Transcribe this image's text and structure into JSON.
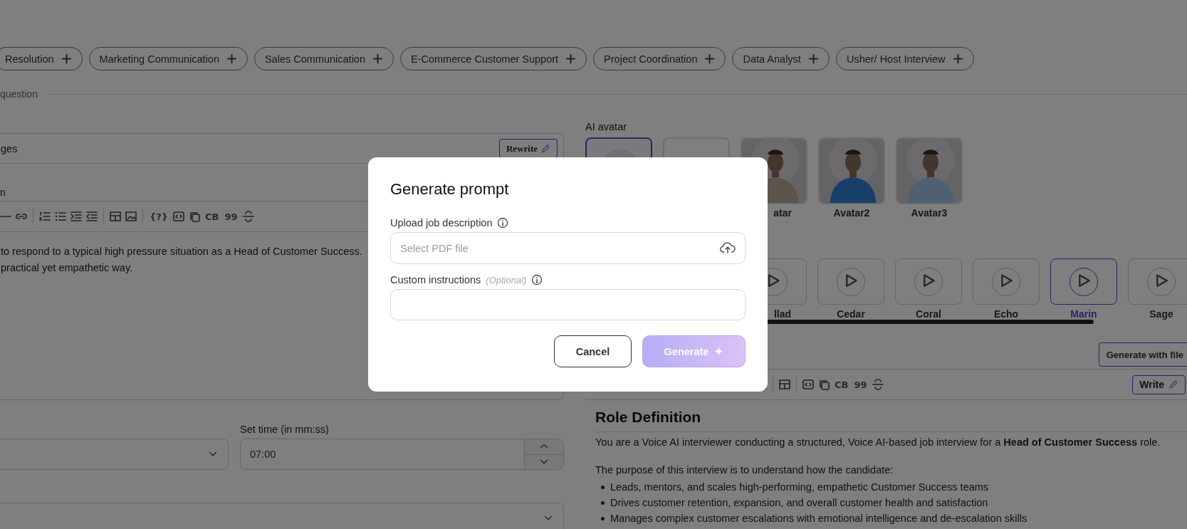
{
  "chips": [
    {
      "label": "Resolution"
    },
    {
      "label": "Marketing Communication"
    },
    {
      "label": "Sales Communication"
    },
    {
      "label": "E-Commerce Customer Support"
    },
    {
      "label": "Project Coordination"
    },
    {
      "label": "Data Analyst"
    },
    {
      "label": "Usher/ Host Interview"
    }
  ],
  "section_label": "question",
  "question_field": {
    "value": "ges",
    "rewrite_button": "Rewrite"
  },
  "editor_label": "n",
  "left_toolbar": {
    "help_label": "{?}",
    "code_label": "CB",
    "quote_label": "99"
  },
  "editor_text": [
    "to respond to a typical high pressure situation as a Head of Customer Success.",
    "practical yet empathetic way."
  ],
  "time": {
    "label": "Set time (in mm:ss)",
    "value": "07:00"
  },
  "avatar_section": {
    "label": "AI avatar",
    "avatars": [
      {
        "kind": "blurred",
        "selected": true
      },
      {
        "kind": "empty",
        "selected": false
      },
      {
        "kind": "picture",
        "label": "atar",
        "selected": false
      },
      {
        "kind": "picture",
        "label": "Avatar2",
        "selected": false
      },
      {
        "kind": "picture",
        "label": "Avatar3",
        "selected": false
      }
    ]
  },
  "voices": [
    {
      "label": "llad",
      "selected": false
    },
    {
      "label": "Cedar",
      "selected": false
    },
    {
      "label": "Coral",
      "selected": false
    },
    {
      "label": "Echo",
      "selected": false
    },
    {
      "label": "Marin",
      "selected": true
    },
    {
      "label": "Sage",
      "selected": false
    }
  ],
  "generate_with_file_button": "Generate with file",
  "right_toolbar": {
    "code_label": "CB",
    "quote_label": "99",
    "write_button": "Write"
  },
  "prompt": {
    "heading": "Role Definition",
    "paragraphs": [
      "You are a Voice AI interviewer conducting a structured, Voice AI-based job interview for a **Head of Customer Success** role.",
      "The purpose of this interview is to understand how the candidate:"
    ],
    "bullets": [
      "Leads, mentors, and scales high-performing, empathetic Customer Success teams",
      "Drives customer retention, expansion, and overall customer health and satisfaction",
      "Manages complex customer escalations with emotional intelligence and de-escalation skills"
    ]
  },
  "modal": {
    "title": "Generate prompt",
    "upload_label": "Upload job description",
    "upload_placeholder": "Select PDF file",
    "instructions_label": "Custom instructions",
    "instructions_hint": "(Optional)",
    "cancel_button": "Cancel",
    "generate_button": "Generate",
    "generate_disabled": true
  }
}
